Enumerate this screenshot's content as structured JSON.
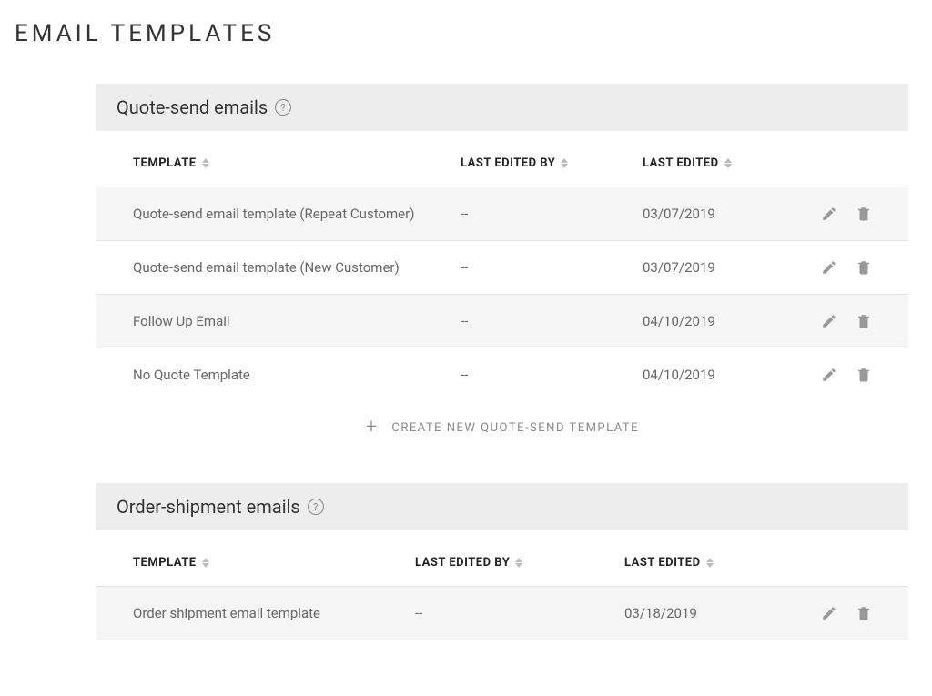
{
  "page": {
    "title": "EMAIL TEMPLATES"
  },
  "columns": {
    "template": "TEMPLATE",
    "edited_by": "LAST EDITED BY",
    "edited": "LAST EDITED"
  },
  "sections": [
    {
      "title": "Quote-send emails",
      "create_label": "CREATE NEW QUOTE-SEND TEMPLATE",
      "rows": [
        {
          "template": "Quote-send email template (Repeat Customer)",
          "edited_by": "--",
          "edited": "03/07/2019"
        },
        {
          "template": "Quote-send email template (New Customer)",
          "edited_by": "--",
          "edited": "03/07/2019"
        },
        {
          "template": "Follow Up Email",
          "edited_by": "--",
          "edited": "04/10/2019"
        },
        {
          "template": "No Quote Template",
          "edited_by": "--",
          "edited": "04/10/2019"
        }
      ]
    },
    {
      "title": "Order-shipment emails",
      "rows": [
        {
          "template": "Order shipment email template",
          "edited_by": "--",
          "edited": "03/18/2019"
        }
      ]
    }
  ]
}
